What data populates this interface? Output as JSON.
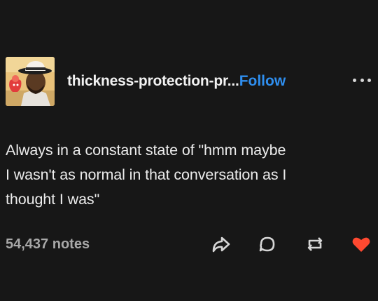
{
  "post": {
    "blog_name": "thickness-protection-pr...",
    "follow_label": "Follow",
    "body_lines": [
      "Always in a constant state of \"hmm maybe",
      "I wasn't as normal in that conversation as I",
      "thought I was\""
    ],
    "notes_label": "54,437 notes"
  },
  "icons": {
    "more": "ellipsis-icon",
    "share": "share-icon",
    "reply": "reply-icon",
    "reblog": "reblog-icon",
    "like": "heart-icon"
  },
  "colors": {
    "background": "#171717",
    "text": "#ececec",
    "follow": "#2f8ff0",
    "notes": "#a8a8a8",
    "heart": "#ff4930"
  }
}
